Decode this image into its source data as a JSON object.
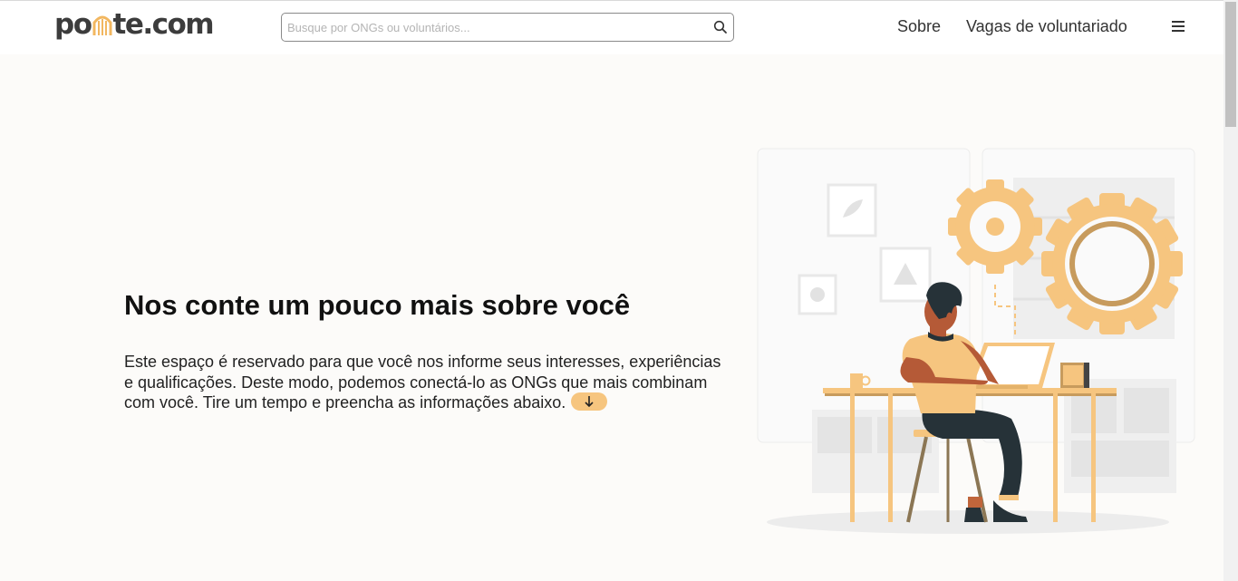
{
  "header": {
    "logo_prefix": "po",
    "logo_suffix": "te.com",
    "search_placeholder": "Busque por ONGs ou voluntários...",
    "nav": {
      "sobre": "Sobre",
      "vagas": "Vagas de voluntariado"
    },
    "menu_icon": "hamburger-icon",
    "search_icon": "search-icon"
  },
  "hero": {
    "title": "Nos conte um pouco mais sobre você",
    "text": "Este espaço é reservado para que você nos informe seus interesses, experiências e qualificações. Deste modo, podemos conectá-lo as ONGs que mais combinam com você. Tire um tempo e preencha as informações abaixo.",
    "scroll_icon": "arrow-down-icon"
  },
  "colors": {
    "accent": "#f6c57f",
    "accent_dark": "#c79b5d",
    "background": "#fcfbf9",
    "text": "#222222"
  }
}
